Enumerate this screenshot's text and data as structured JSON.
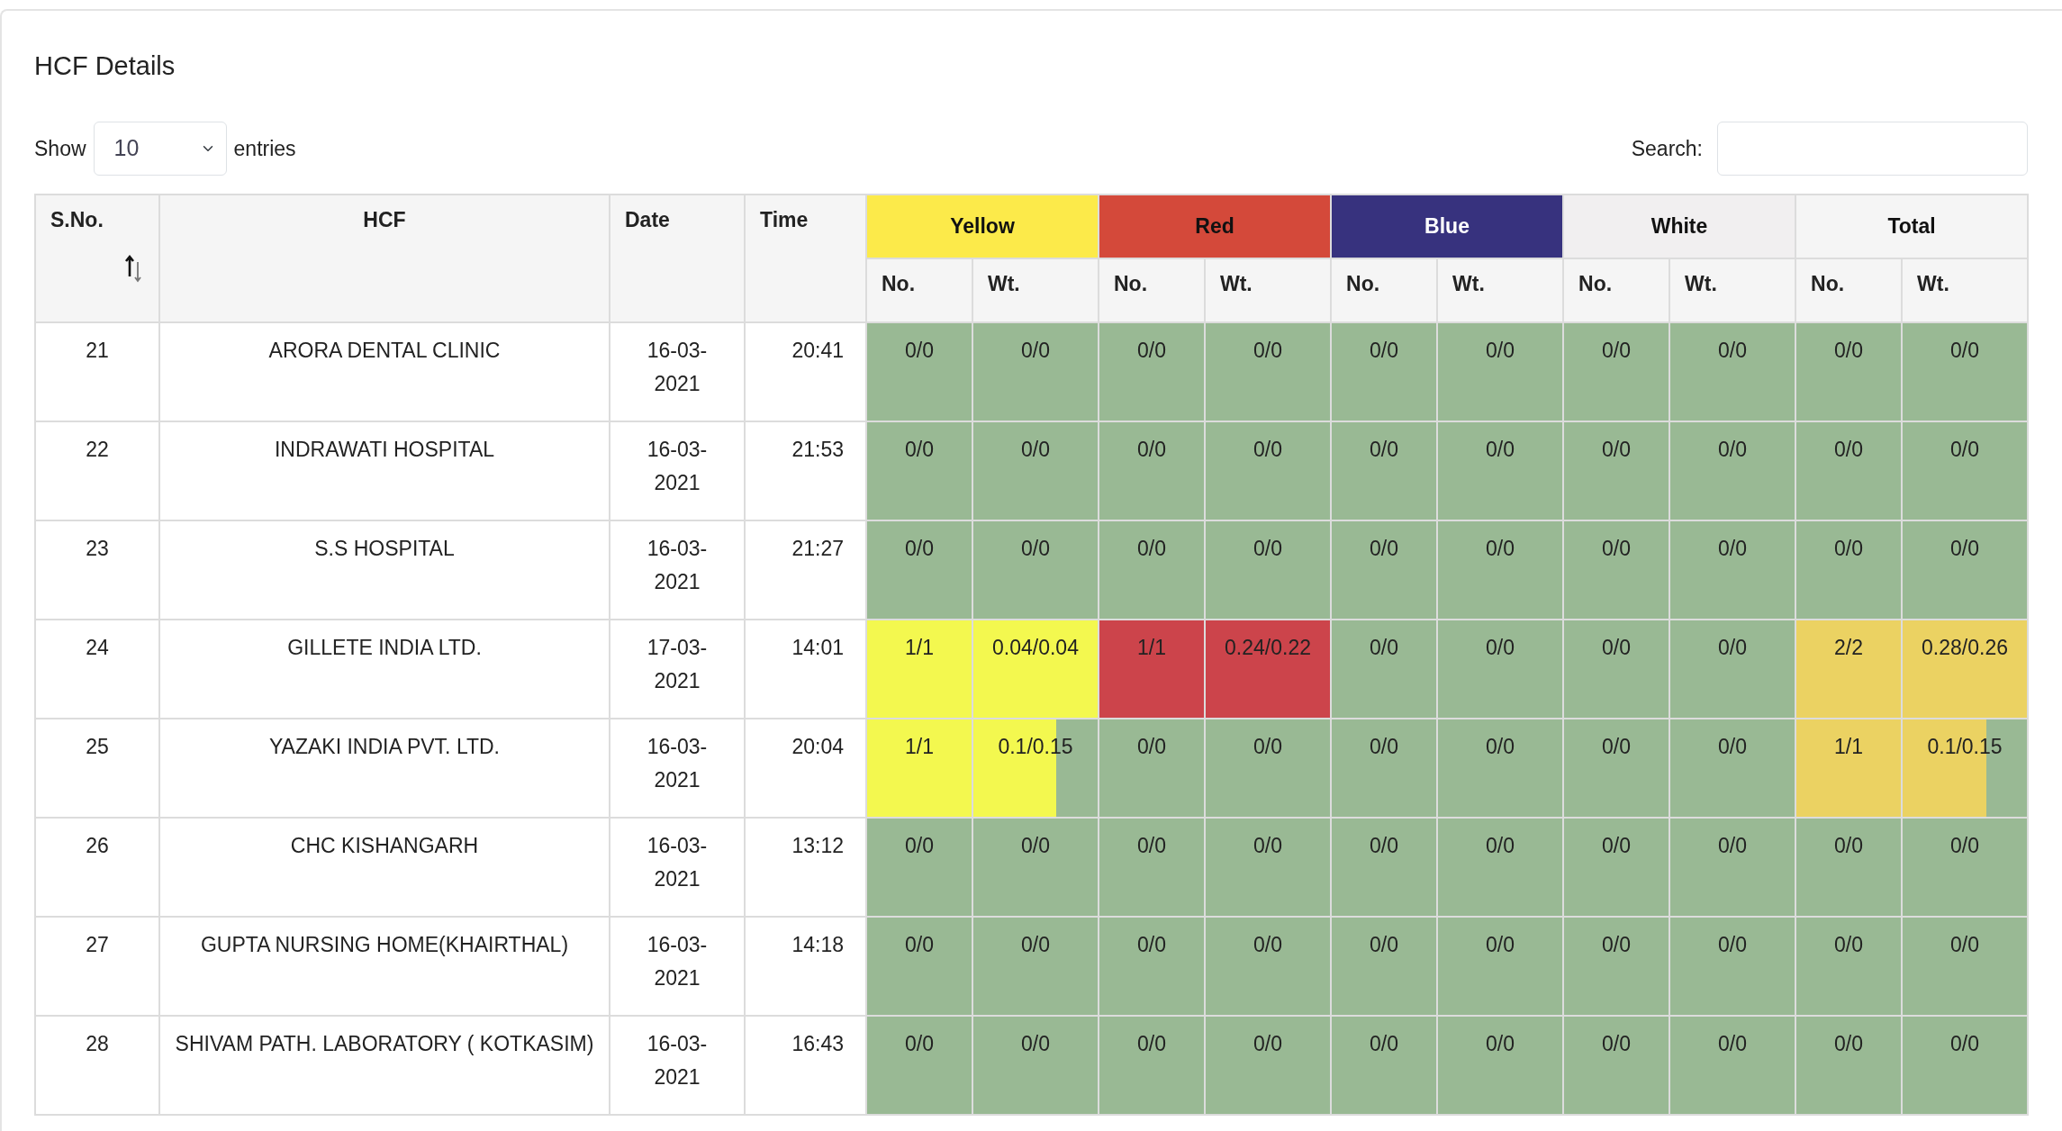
{
  "title": "HCF Details",
  "length_menu": {
    "prefix": "Show",
    "value": "10",
    "suffix": "entries"
  },
  "search": {
    "label": "Search:"
  },
  "table": {
    "columns": [
      "S.No.",
      "HCF",
      "Date",
      "Time"
    ],
    "groups": [
      {
        "label": "Yellow",
        "color": "#fcea4a",
        "subcolumns": [
          "No.",
          "Wt."
        ]
      },
      {
        "label": "Red",
        "color": "#d4493a",
        "subcolumns": [
          "No.",
          "Wt."
        ]
      },
      {
        "label": "Blue",
        "color": "#37327e",
        "subcolumns": [
          "No.",
          "Wt."
        ]
      },
      {
        "label": "White",
        "color": "#f1eff0",
        "subcolumns": [
          "No.",
          "Wt."
        ]
      },
      {
        "label": "Total",
        "color": "#f5f5f5",
        "subcolumns": [
          "No.",
          "Wt."
        ]
      }
    ],
    "rows": [
      {
        "sno": "21",
        "hcf": "ARORA DENTAL CLINIC",
        "date": "16-03-2021",
        "time": "20:41",
        "cells": [
          {
            "text": "0/0",
            "color": "#99b994"
          },
          {
            "text": "0/0",
            "color": "#99b994"
          },
          {
            "text": "0/0",
            "color": "#99b994"
          },
          {
            "text": "0/0",
            "color": "#99b994"
          },
          {
            "text": "0/0",
            "color": "#99b994"
          },
          {
            "text": "0/0",
            "color": "#99b994"
          },
          {
            "text": "0/0",
            "color": "#99b994"
          },
          {
            "text": "0/0",
            "color": "#99b994"
          },
          {
            "text": "0/0",
            "color": "#99b994"
          },
          {
            "text": "0/0",
            "color": "#99b994"
          }
        ]
      },
      {
        "sno": "22",
        "hcf": "INDRAWATI HOSPITAL",
        "date": "16-03-2021",
        "time": "21:53",
        "cells": [
          {
            "text": "0/0",
            "color": "#99b994"
          },
          {
            "text": "0/0",
            "color": "#99b994"
          },
          {
            "text": "0/0",
            "color": "#99b994"
          },
          {
            "text": "0/0",
            "color": "#99b994"
          },
          {
            "text": "0/0",
            "color": "#99b994"
          },
          {
            "text": "0/0",
            "color": "#99b994"
          },
          {
            "text": "0/0",
            "color": "#99b994"
          },
          {
            "text": "0/0",
            "color": "#99b994"
          },
          {
            "text": "0/0",
            "color": "#99b994"
          },
          {
            "text": "0/0",
            "color": "#99b994"
          }
        ]
      },
      {
        "sno": "23",
        "hcf": "S.S HOSPITAL",
        "date": "16-03-2021",
        "time": "21:27",
        "cells": [
          {
            "text": "0/0",
            "color": "#99b994"
          },
          {
            "text": "0/0",
            "color": "#99b994"
          },
          {
            "text": "0/0",
            "color": "#99b994"
          },
          {
            "text": "0/0",
            "color": "#99b994"
          },
          {
            "text": "0/0",
            "color": "#99b994"
          },
          {
            "text": "0/0",
            "color": "#99b994"
          },
          {
            "text": "0/0",
            "color": "#99b994"
          },
          {
            "text": "0/0",
            "color": "#99b994"
          },
          {
            "text": "0/0",
            "color": "#99b994"
          },
          {
            "text": "0/0",
            "color": "#99b994"
          }
        ]
      },
      {
        "sno": "24",
        "hcf": "GILLETE INDIA LTD.",
        "date": "17-03-2021",
        "time": "14:01",
        "cells": [
          {
            "text": "1/1",
            "color": "#f3f84f"
          },
          {
            "text": "0.04/0.04",
            "color": "#f3f84f"
          },
          {
            "text": "1/1",
            "color": "#cc444b"
          },
          {
            "text": "0.24/0.22",
            "color": "#cc444b"
          },
          {
            "text": "0/0",
            "color": "#99b994"
          },
          {
            "text": "0/0",
            "color": "#99b994"
          },
          {
            "text": "0/0",
            "color": "#99b994"
          },
          {
            "text": "0/0",
            "color": "#99b994"
          },
          {
            "text": "2/2",
            "color": "#ebd262"
          },
          {
            "text": "0.28/0.26",
            "color": "#ebd262"
          }
        ]
      },
      {
        "sno": "25",
        "hcf": "YAZAKI INDIA PVT. LTD.",
        "date": "16-03-2021",
        "time": "20:04",
        "cells": [
          {
            "text": "1/1",
            "color": "#f3f84f"
          },
          {
            "text": "0.1/0.15",
            "color": "#f3f84f",
            "level": 0.67
          },
          {
            "text": "0/0",
            "color": "#99b994"
          },
          {
            "text": "0/0",
            "color": "#99b994"
          },
          {
            "text": "0/0",
            "color": "#99b994"
          },
          {
            "text": "0/0",
            "color": "#99b994"
          },
          {
            "text": "0/0",
            "color": "#99b994"
          },
          {
            "text": "0/0",
            "color": "#99b994"
          },
          {
            "text": "1/1",
            "color": "#ebd262"
          },
          {
            "text": "0.1/0.15",
            "color": "#ebd262",
            "level": 0.67
          }
        ]
      },
      {
        "sno": "26",
        "hcf": "CHC KISHANGARH",
        "date": "16-03-2021",
        "time": "13:12",
        "cells": [
          {
            "text": "0/0",
            "color": "#99b994"
          },
          {
            "text": "0/0",
            "color": "#99b994"
          },
          {
            "text": "0/0",
            "color": "#99b994"
          },
          {
            "text": "0/0",
            "color": "#99b994"
          },
          {
            "text": "0/0",
            "color": "#99b994"
          },
          {
            "text": "0/0",
            "color": "#99b994"
          },
          {
            "text": "0/0",
            "color": "#99b994"
          },
          {
            "text": "0/0",
            "color": "#99b994"
          },
          {
            "text": "0/0",
            "color": "#99b994"
          },
          {
            "text": "0/0",
            "color": "#99b994"
          }
        ]
      },
      {
        "sno": "27",
        "hcf": "GUPTA NURSING HOME(KHAIRTHAL)",
        "date": "16-03-2021",
        "time": "14:18",
        "cells": [
          {
            "text": "0/0",
            "color": "#99b994"
          },
          {
            "text": "0/0",
            "color": "#99b994"
          },
          {
            "text": "0/0",
            "color": "#99b994"
          },
          {
            "text": "0/0",
            "color": "#99b994"
          },
          {
            "text": "0/0",
            "color": "#99b994"
          },
          {
            "text": "0/0",
            "color": "#99b994"
          },
          {
            "text": "0/0",
            "color": "#99b994"
          },
          {
            "text": "0/0",
            "color": "#99b994"
          },
          {
            "text": "0/0",
            "color": "#99b994"
          },
          {
            "text": "0/0",
            "color": "#99b994"
          }
        ]
      },
      {
        "sno": "28",
        "hcf": "SHIVAM PATH. LABORATORY ( KOTKASIM)",
        "date": "16-03-2021",
        "time": "16:43",
        "cells": [
          {
            "text": "0/0",
            "color": "#99b994"
          },
          {
            "text": "0/0",
            "color": "#99b994"
          },
          {
            "text": "0/0",
            "color": "#99b994"
          },
          {
            "text": "0/0",
            "color": "#99b994"
          },
          {
            "text": "0/0",
            "color": "#99b994"
          },
          {
            "text": "0/0",
            "color": "#99b994"
          },
          {
            "text": "0/0",
            "color": "#99b994"
          },
          {
            "text": "0/0",
            "color": "#99b994"
          },
          {
            "text": "0/0",
            "color": "#99b994"
          },
          {
            "text": "0/0",
            "color": "#99b994"
          }
        ]
      }
    ]
  }
}
